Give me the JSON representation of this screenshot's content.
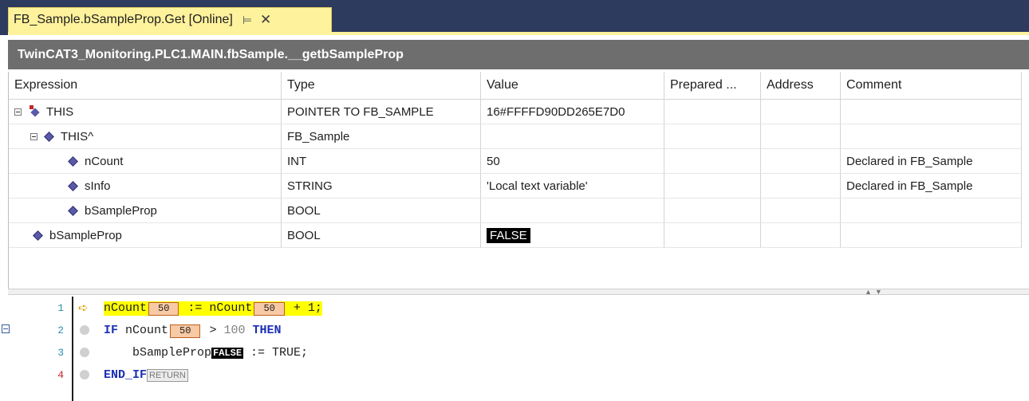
{
  "tab": {
    "title": "FB_Sample.bSampleProp.Get [Online]",
    "pin": "⊨",
    "close": "✕"
  },
  "path": "TwinCAT3_Monitoring.PLC1.MAIN.fbSample.__getbSampleProp",
  "columns": [
    "Expression",
    "Type",
    "Value",
    "Prepared ...",
    "Address",
    "Comment"
  ],
  "rows": [
    {
      "expression": "THIS",
      "type": "POINTER TO FB_SAMPLE",
      "value": "16#FFFFD90DD265E7D0",
      "prepared": "",
      "address": "",
      "comment": ""
    },
    {
      "expression": "THIS^",
      "type": "FB_Sample",
      "value": "",
      "prepared": "",
      "address": "",
      "comment": ""
    },
    {
      "expression": "nCount",
      "type": "INT",
      "value": "50",
      "prepared": "",
      "address": "",
      "comment": "Declared in FB_Sample"
    },
    {
      "expression": "sInfo",
      "type": "STRING",
      "value": "'Local text variable'",
      "prepared": "",
      "address": "",
      "comment": "Declared in FB_Sample"
    },
    {
      "expression": "bSampleProp",
      "type": "BOOL",
      "value": "",
      "prepared": "",
      "address": "",
      "comment": ""
    },
    {
      "expression": "bSampleProp",
      "type": "BOOL",
      "value": "FALSE",
      "prepared": "",
      "address": "",
      "comment": ""
    }
  ],
  "code": {
    "line_numbers": [
      "1",
      "2",
      "3",
      "4"
    ],
    "l1": {
      "a": "nCount",
      "v1": "50",
      "b": " := nCount",
      "v2": "50",
      "c": " + 1;"
    },
    "l2": {
      "kw1": "IF",
      "a": " nCount",
      "v1": "50",
      "b": " > ",
      "n": "100",
      "kw2": " THEN"
    },
    "l3": {
      "a": "    bSampleProp",
      "v1": "FALSE",
      "b": " := TRUE;"
    },
    "l4": {
      "kw1": "END_IF",
      "ret": "RETURN"
    }
  },
  "colors": {
    "tab_active": "#fff29d",
    "tabstrip": "#2d3b5e",
    "path_header": "#6e6e6e",
    "current_line": "#ffff00",
    "keyword": "#1c2fb5",
    "inline_value": "#f7c9a5"
  }
}
